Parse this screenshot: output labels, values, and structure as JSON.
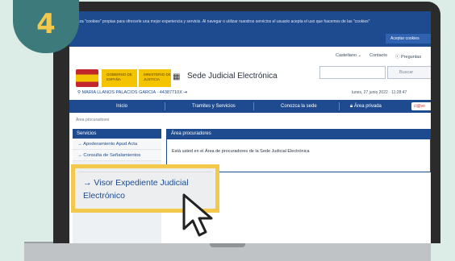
{
  "step_badge": "4",
  "cookie": {
    "text": "Utiliza \"cookies\" propias para ofrecerle una mejor experiencia y servicio. Al navegar o utilizar nuestros servicios el usuario acepta el uso que hacemos de las \"cookies\"",
    "accept_label": "Aceptar cookies"
  },
  "top_links": {
    "language": "Castellano",
    "contact": "Contacto",
    "preguntas": "Preguntas"
  },
  "search": {
    "button_label": "Buscar"
  },
  "logos": {
    "gobierno": "GOBIERNO DE ESPAÑA",
    "ministerio": "MINISTERIO DE JUSTICIA"
  },
  "site_title": "Sede Judicial Electrónica",
  "user": {
    "name": "MARIA LLANOS PALACIOS GARCIA",
    "id": "44387710X"
  },
  "date": "lunes, 27 junio 2022 · 11:28:47",
  "nav": {
    "inicio": "Inicio",
    "tramites": "Tramites y Servicios",
    "conozca": "Conozca la sede",
    "privada": "Área privada",
    "badge": "cl@ve"
  },
  "breadcrumb": "Área procuradores",
  "sidebar": {
    "header": "Servicios",
    "items": [
      {
        "label": "Apoderamiento Apud Acta"
      },
      {
        "label": "Consulta de Señalamientos"
      }
    ]
  },
  "panel": {
    "header": "Área procuradores",
    "body": "Está usted en el Área de procuradores de la Sede Judicial Electrónica"
  },
  "highlight": {
    "label_line1": "→  Visor Expediente Judicial",
    "label_line2": "Electrónico"
  },
  "colors": {
    "primary": "#1e4b90",
    "highlight": "#f2c94c",
    "badge": "#3d7a7c",
    "background": "#dcece6"
  }
}
